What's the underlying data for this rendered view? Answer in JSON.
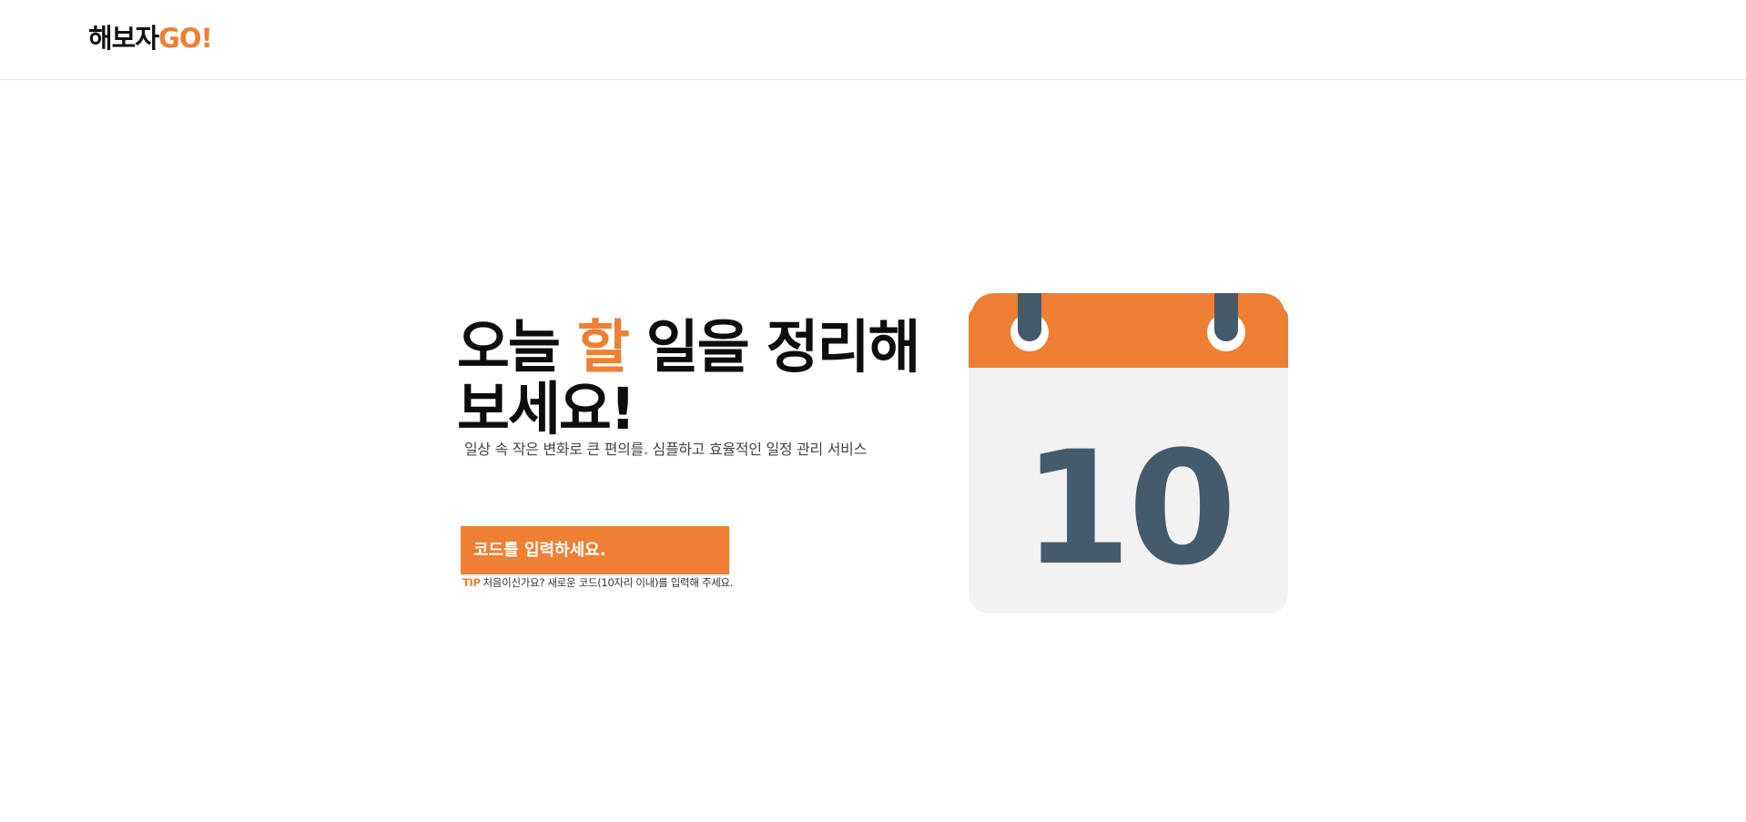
{
  "header": {
    "logo_text": "해보자",
    "logo_accent": "GO!"
  },
  "hero": {
    "title_part1": "오늘 ",
    "title_accent": "할",
    "title_part2": " 일을 정리해 보세요!",
    "subtitle": "일상 속 작은 변화로 큰 편의를. 심플하고 효율적인 일정 관리 서비스"
  },
  "code_input": {
    "placeholder": "코드를 입력하세요.",
    "value": ""
  },
  "tip": {
    "label": "TIP",
    "text": "처음이신가요? 새로운 코드(10자리 이내)를 입력해 주세요."
  },
  "calendar": {
    "day": "10",
    "icon": "calendar-icon"
  },
  "colors": {
    "accent": "#ee7f33",
    "calendar_dark": "#445a6d",
    "calendar_body": "#f2f2f2"
  }
}
